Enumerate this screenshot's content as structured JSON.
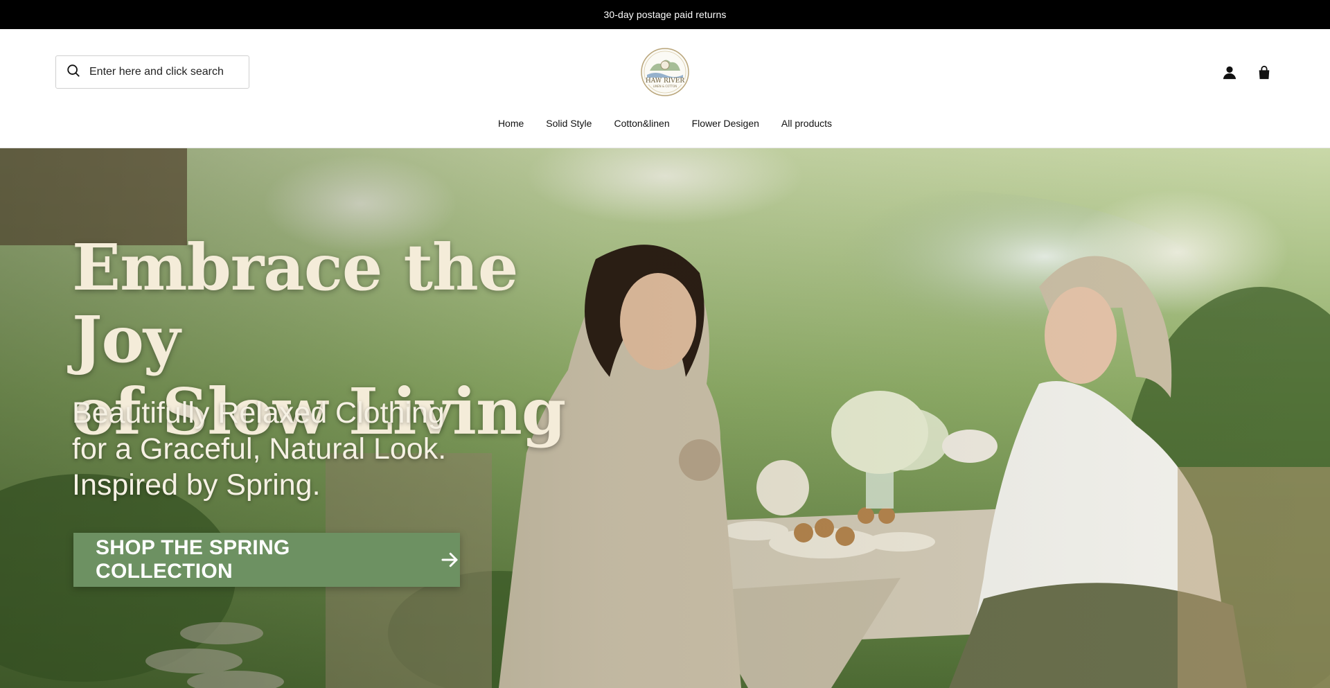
{
  "announcement": {
    "text": "30-day postage paid returns"
  },
  "header": {
    "search": {
      "placeholder": "Enter here and click search",
      "icon": "search-icon"
    },
    "logo": {
      "name": "HAW RIVER",
      "tagline": "LINEN & COTTON",
      "icon": "haw-river-logo"
    },
    "icons": {
      "account": "account-icon",
      "cart": "shopping-bag-icon"
    }
  },
  "nav": {
    "items": [
      {
        "label": "Home"
      },
      {
        "label": "Solid Style"
      },
      {
        "label": "Cotton&linen"
      },
      {
        "label": "Flower Desigen"
      },
      {
        "label": "All products"
      }
    ]
  },
  "hero": {
    "title_line1": "Embrace the Joy",
    "title_line2": "of Slow Living",
    "subtitle_line1": "Beautifully Relaxed Clothing",
    "subtitle_line2": "for a Graceful, Natural Look.",
    "subtitle_line3": "Inspired by Spring.",
    "cta_label": "SHOP THE SPRING COLLECTION",
    "cta_color": "#6d9162"
  }
}
